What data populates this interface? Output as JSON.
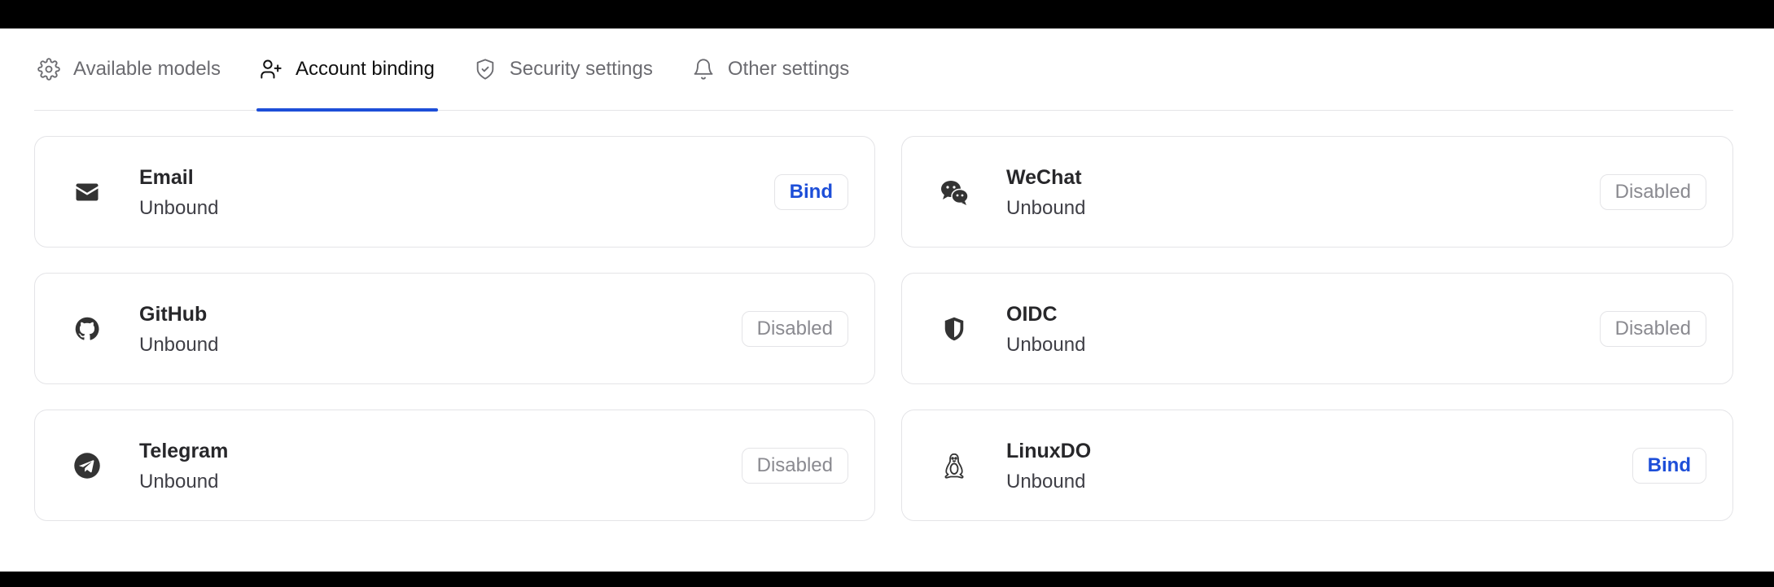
{
  "tabs": [
    {
      "label": "Available models",
      "icon": "gear-icon",
      "active": false
    },
    {
      "label": "Account binding",
      "icon": "user-plus-icon",
      "active": true
    },
    {
      "label": "Security settings",
      "icon": "shield-check-icon",
      "active": false
    },
    {
      "label": "Other settings",
      "icon": "bell-icon",
      "active": false
    }
  ],
  "accounts": {
    "email": {
      "name": "Email",
      "status": "Unbound",
      "action": "Bind",
      "icon": "mail-icon"
    },
    "wechat": {
      "name": "WeChat",
      "status": "Unbound",
      "action": "Disabled",
      "icon": "wechat-icon"
    },
    "github": {
      "name": "GitHub",
      "status": "Unbound",
      "action": "Disabled",
      "icon": "github-icon"
    },
    "oidc": {
      "name": "OIDC",
      "status": "Unbound",
      "action": "Disabled",
      "icon": "shield-icon"
    },
    "telegram": {
      "name": "Telegram",
      "status": "Unbound",
      "action": "Disabled",
      "icon": "telegram-icon"
    },
    "linuxdo": {
      "name": "LinuxDO",
      "status": "Unbound",
      "action": "Bind",
      "icon": "tux-icon"
    }
  },
  "colors": {
    "accent": "#1d4ed8",
    "border": "#e4e4e7",
    "muted": "#8a8a90"
  }
}
